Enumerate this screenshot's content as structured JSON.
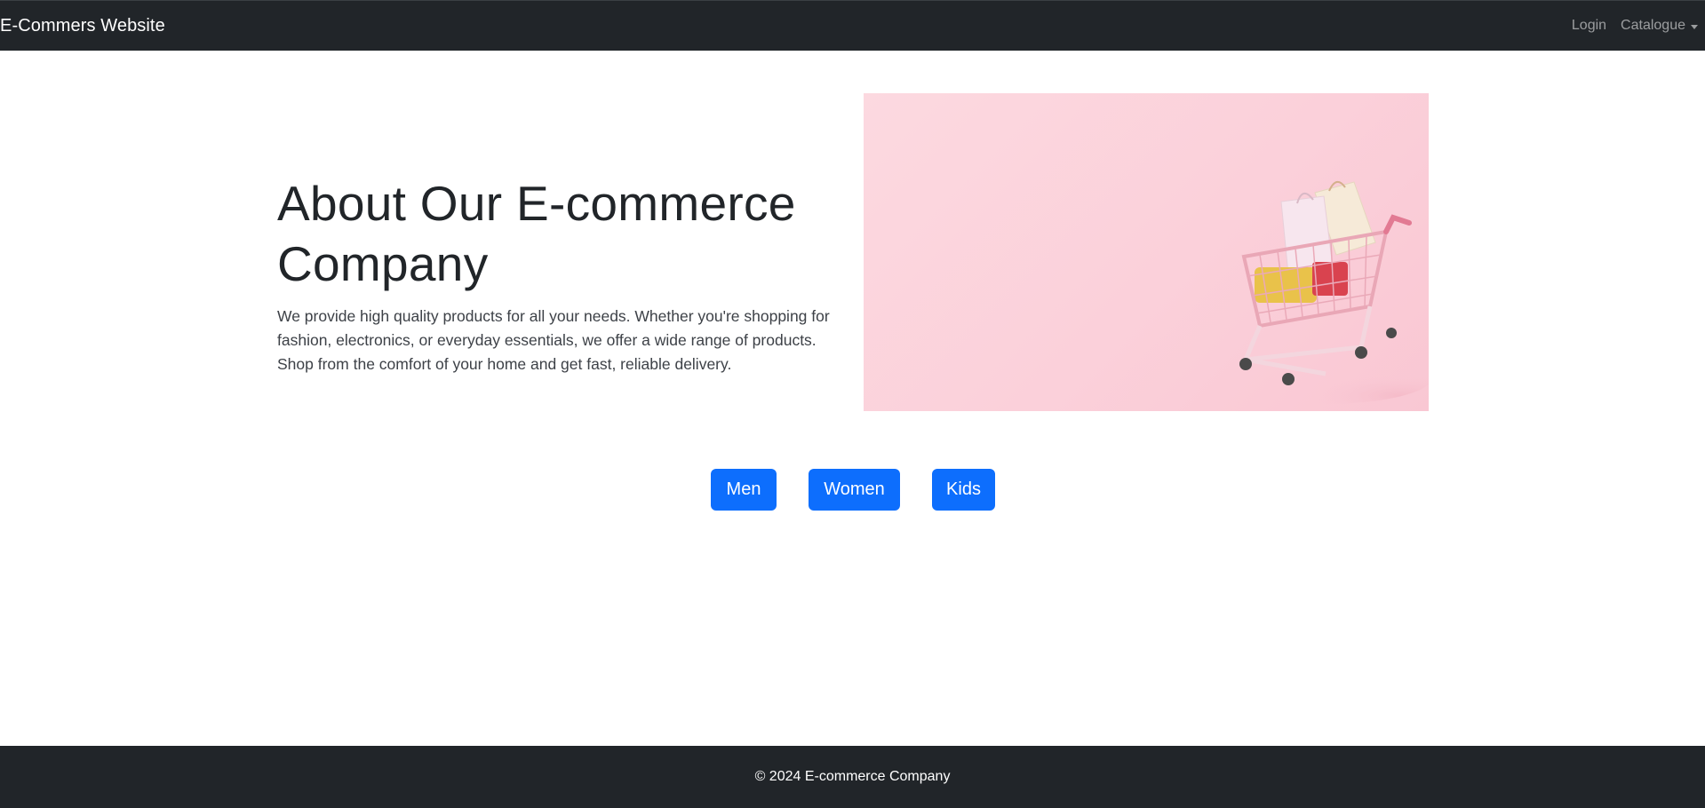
{
  "navbar": {
    "brand": "E-Commers Website",
    "login_label": "Login",
    "catalogue_label": "Catalogue"
  },
  "about": {
    "heading": "About Our E-commerce Company",
    "description": "We provide high quality products for all your needs. Whether you're shopping for fashion, electronics, or everyday essentials, we offer a wide range of products. Shop from the comfort of your home and get fast, reliable delivery."
  },
  "hero_image": {
    "icon": "shopping-cart-with-bags-image",
    "background_color": "#fbd0da"
  },
  "categories": {
    "men_label": "Men",
    "women_label": "Women",
    "kids_label": "Kids",
    "button_color": "#0d6efd"
  },
  "footer": {
    "copyright": "© 2024 E-commerce Company"
  }
}
